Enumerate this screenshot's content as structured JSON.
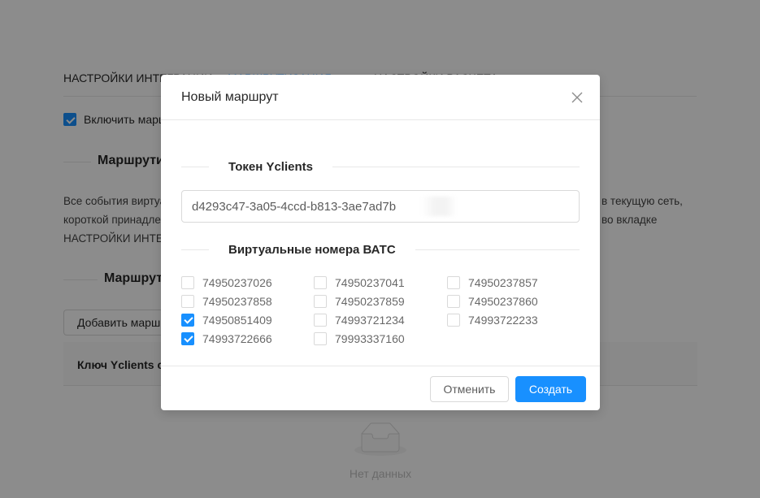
{
  "background": {
    "tabs": [
      {
        "label": "НАСТРОЙКИ ИНТЕГРАЦИИ",
        "active": false
      },
      {
        "label": "МАРШРУТИЗАЦИЯ",
        "active": true
      },
      {
        "label": "НАСТРОЙКИ РАСЧЕТА",
        "active": false
      }
    ],
    "enable_checkbox_label": "Включить маршрутизацию",
    "enable_checked": true,
    "heading_routes": "Маршрутизация",
    "paragraph_line1": "Все события виртуальных номеров будут маршрутизироваться",
    "paragraph_line1_right": "в текущую сеть,",
    "paragraph_line2": "короткой принадлежности",
    "paragraph_line2_right": "во вкладке",
    "paragraph_line3": "НАСТРОЙКИ ИНТЕГРАЦИИ",
    "heading_route_list": "Маршруты",
    "add_route_button": "Добавить маршрут",
    "table_col_key": "Ключ Yclients сети",
    "empty_text": "Нет данных"
  },
  "modal": {
    "title": "Новый маршрут",
    "close_icon": "close-icon",
    "token_section_title": "Токен Yclients",
    "token_value": "d4293c47-3a05-4ccd-b813-3ae7ad7b",
    "numbers_section_title": "Виртуальные номера ВАТС",
    "numbers": [
      {
        "number": "74950237026",
        "checked": false
      },
      {
        "number": "74950237041",
        "checked": false
      },
      {
        "number": "74950237857",
        "checked": false
      },
      {
        "number": "74950237858",
        "checked": false
      },
      {
        "number": "74950237859",
        "checked": false
      },
      {
        "number": "74950237860",
        "checked": false
      },
      {
        "number": "74950851409",
        "checked": true
      },
      {
        "number": "74993721234",
        "checked": false
      },
      {
        "number": "74993722233",
        "checked": false
      },
      {
        "number": "74993722666",
        "checked": true
      },
      {
        "number": "79993337160",
        "checked": false
      }
    ],
    "cancel_label": "Отменить",
    "create_label": "Создать"
  },
  "colors": {
    "primary": "#1890ff",
    "border": "#d9d9d9",
    "mask": "rgba(0,0,0,0.45)"
  }
}
